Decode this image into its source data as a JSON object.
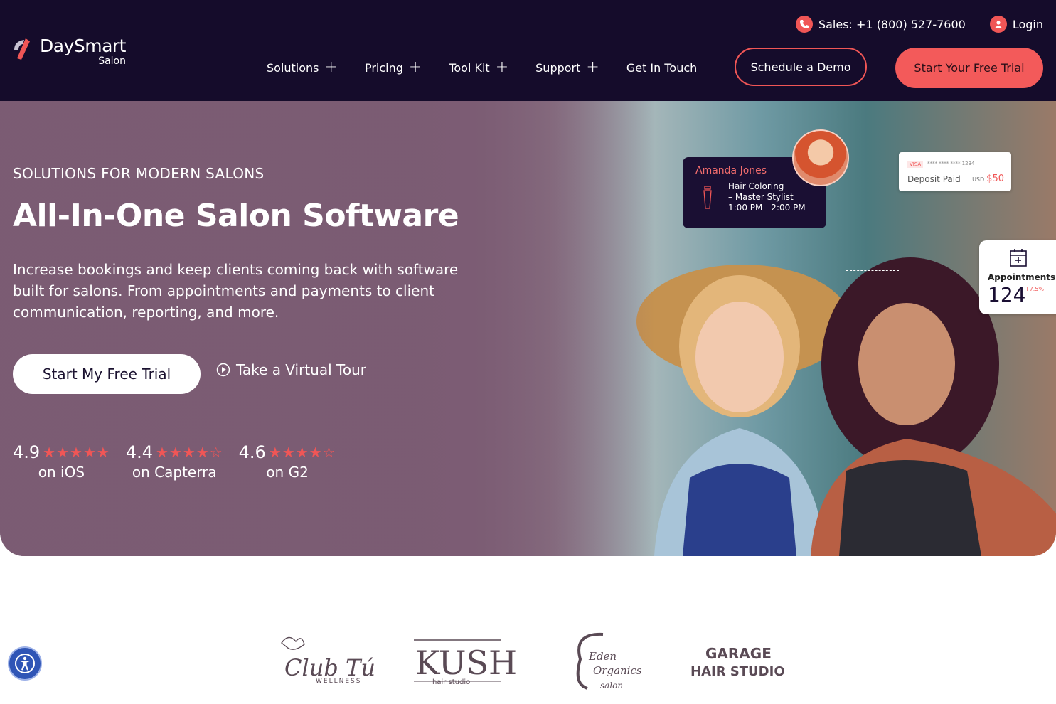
{
  "brand": {
    "name": "DaySmart",
    "sub": "Salon"
  },
  "topbar": {
    "sales": "Sales: +1 (800) 527-7600",
    "login": "Login"
  },
  "nav": {
    "items": [
      {
        "label": "Solutions"
      },
      {
        "label": "Pricing"
      },
      {
        "label": "Tool Kit"
      },
      {
        "label": "Support"
      },
      {
        "label": "Get In Touch"
      }
    ],
    "demo_label": "Schedule a Demo",
    "trial_label": "Start Your Free Trial"
  },
  "hero": {
    "eyebrow": "SOLUTIONS FOR MODERN SALONS",
    "headline": "All-In-One Salon Software",
    "subtext": "Increase bookings and keep clients coming back with software built for salons. From appointments and payments to client communication, reporting, and more.",
    "cta_label": "Start My Free Trial",
    "tour_label": "Take a Virtual Tour",
    "ratings": [
      {
        "score": "4.9",
        "stars": "★★★★★",
        "label": "on iOS"
      },
      {
        "score": "4.4",
        "stars": "★★★★☆",
        "label": "on Capterra"
      },
      {
        "score": "4.6",
        "stars": "★★★★☆",
        "label": "on G2"
      }
    ]
  },
  "appointment_card": {
    "name": "Amanda Jones",
    "service_line1": "Hair Coloring",
    "service_line2": "– Master Stylist",
    "time": "1:00 PM - 2:00 PM"
  },
  "deposit_card": {
    "brand": "VISA",
    "card_number": "**** **** **** 1234",
    "label": "Deposit Paid",
    "currency": "USD",
    "amount": "$50"
  },
  "stats_card": {
    "label": "Appointments",
    "value": "124",
    "delta": "+7.5%"
  },
  "client_logos": {
    "clubtu": "Club Tú",
    "clubtu_sub": "WELLNESS",
    "kush": "KUSH",
    "kush_sub": "hair studio",
    "eden_1": "Eden",
    "eden_2": "Organics",
    "eden_3": "salon",
    "garage_1": "GARAGE",
    "garage_2": "HAIR STUDIO"
  },
  "colors": {
    "header_bg": "#150c2b",
    "accent": "#f05656",
    "hero_overlay": "#7b5b73"
  }
}
